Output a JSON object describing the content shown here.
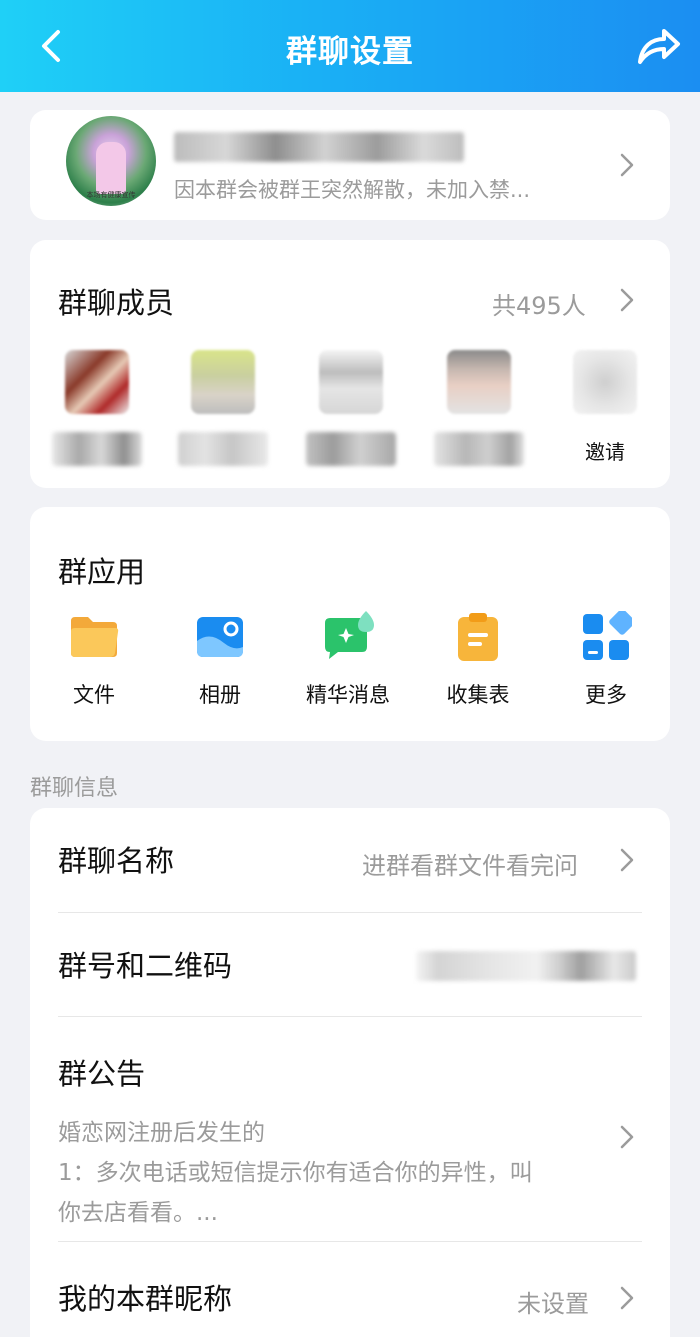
{
  "header": {
    "title": "群聊设置"
  },
  "group": {
    "subtitle": "因本群会被群王突然解散，未加入禁...",
    "avatar_caption": "本场有健康宣传"
  },
  "members": {
    "title": "群聊成员",
    "count": "共495人",
    "invite_label": "邀请"
  },
  "apps": {
    "title": "群应用",
    "items": [
      {
        "label": "文件",
        "icon": "folder-icon"
      },
      {
        "label": "相册",
        "icon": "album-icon"
      },
      {
        "label": "精华消息",
        "icon": "essence-message-icon"
      },
      {
        "label": "收集表",
        "icon": "collection-form-icon"
      },
      {
        "label": "更多",
        "icon": "more-apps-icon"
      }
    ]
  },
  "info": {
    "section_label": "群聊信息",
    "name_label": "群聊名称",
    "name_value": "进群看群文件看完问",
    "qr_label": "群号和二维码",
    "notice_label": "群公告",
    "notice_lines": [
      "婚恋网注册后发生的",
      "1：多次电话或短信提示你有适合你的异性，叫",
      "你去店看看。..."
    ],
    "nickname_label": "我的本群昵称",
    "nickname_value": "未设置"
  },
  "colors": {
    "header_gradient_start": "#1fd0f7",
    "header_gradient_end": "#1b8ef2",
    "background": "#f1f2f6",
    "secondary_text": "#9b9b9b",
    "accent_blue": "#1a8cf0",
    "folder_yellow": "#f7bb3f",
    "essence_green": "#2bc36b"
  }
}
